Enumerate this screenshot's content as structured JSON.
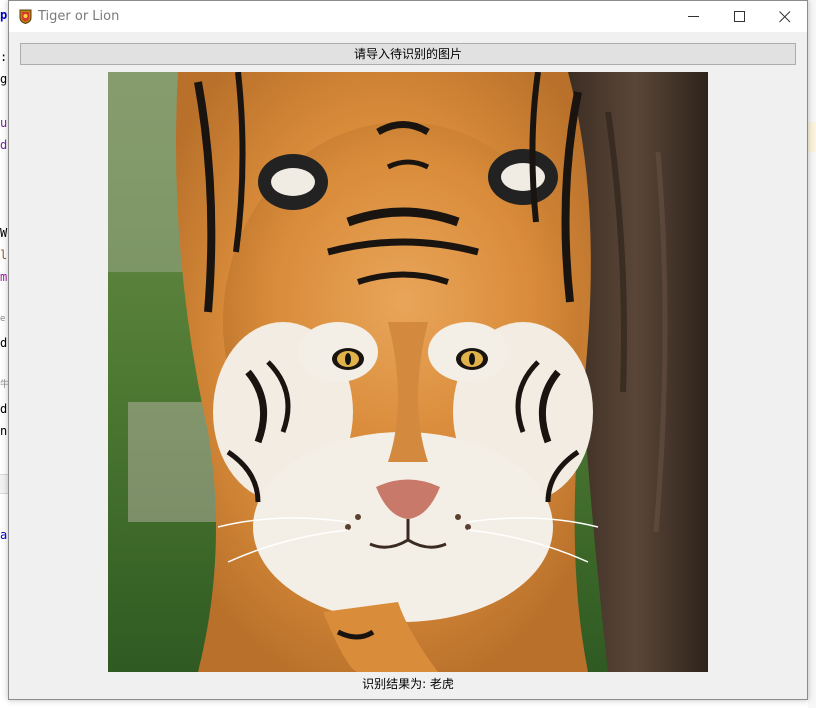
{
  "window": {
    "title": "Tiger or Lion",
    "controls": [
      "minimize-icon",
      "maximize-icon",
      "close-icon"
    ]
  },
  "import_button": {
    "label": "请导入待识别的图片"
  },
  "image": {
    "subject": "tiger",
    "icon": "tiger-photo"
  },
  "result": {
    "text": "识别结果为: 老虎"
  },
  "background_editor": {
    "fragments": [
      {
        "text": "p",
        "color": "#0000cc"
      },
      {
        "text": ":",
        "color": "#000000"
      },
      {
        "text": "ge",
        "color": "#000000"
      },
      {
        "text": "ut",
        "color": "#7a1fa2"
      },
      {
        "text": "de",
        "color": "#7a1fa2"
      },
      {
        "text": "Wi",
        "color": "#000000"
      },
      {
        "text": "lt",
        "color": "#a0522d"
      },
      {
        "text": "mi",
        "color": "#a020a0"
      },
      {
        "text": "e",
        "color": "#888888"
      },
      {
        "text": "do",
        "color": "#000000"
      },
      {
        "text": "牛",
        "color": "#888888"
      },
      {
        "text": "do",
        "color": "#000000"
      },
      {
        "text": "ne",
        "color": "#000000"
      },
      {
        "text": "a",
        "color": "#0000cc"
      }
    ]
  },
  "colors": {
    "window_bg": "#f0f0f0",
    "button_bg": "#e1e1e1",
    "title_text": "#7a7a7a"
  }
}
